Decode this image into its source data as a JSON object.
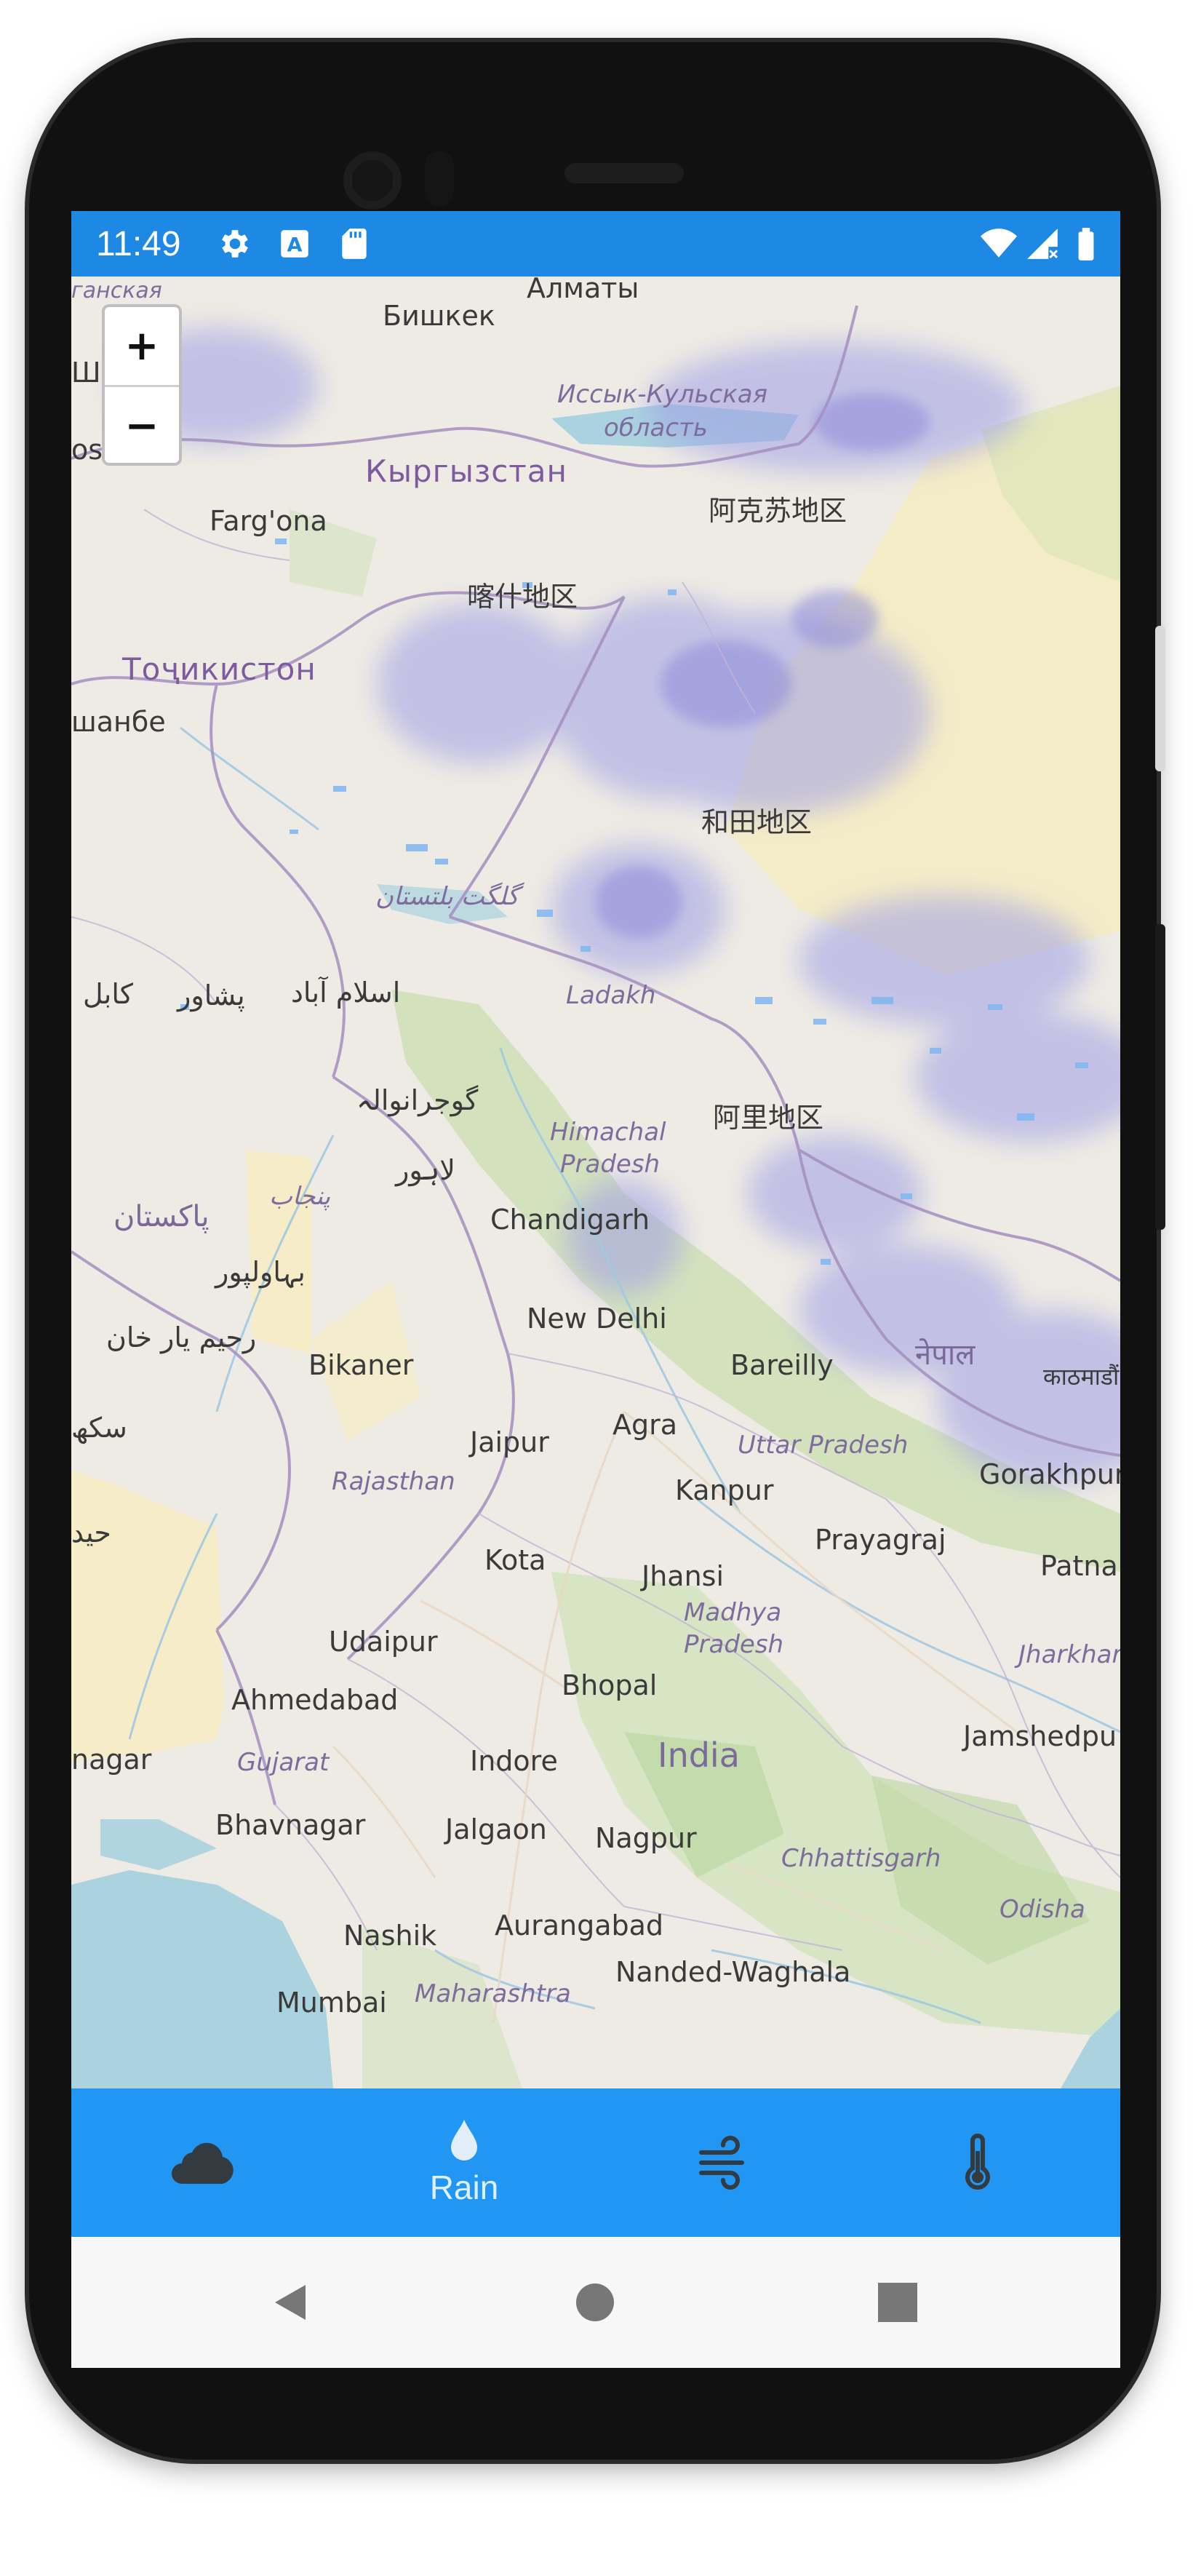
{
  "status_bar": {
    "time": "11:49",
    "left_icons": [
      "settings-icon",
      "text-a-icon",
      "sd-card-icon"
    ],
    "right_icons": [
      "wifi-icon",
      "signal-no-data-icon",
      "battery-icon"
    ]
  },
  "map": {
    "zoom_in_label": "+",
    "zoom_out_label": "−",
    "labels": {
      "almaty": "Алматы",
      "bishkek": "Бишкек",
      "issyk_kul": "Иссык-Кульская",
      "oblast": "область",
      "kyrgyzstan": "Кыргызстан",
      "aksu": "阿克苏地区",
      "fargona": "Farg'ona",
      "kashgar": "喀什地区",
      "tajikistan": "Тоҷикистон",
      "dushanbe": "шанбе",
      "hotan": "和田地区",
      "gilgit": "گلگت بلتستان",
      "kabul": "کابل",
      "peshawar": "پشاور",
      "islamabad": "اسلام آباد",
      "ladakh": "Ladakh",
      "gujranwala": "گوجرانوالہ",
      "ngari": "阿里地区",
      "himachal": "Himachal",
      "pradesh_h": "Pradesh",
      "lahore": "لاہور",
      "punjab": "پنجاب",
      "pakistan": "پاکستان",
      "chandigarh": "Chandigarh",
      "bahawalpur": "بہاولپور",
      "new_delhi": "New Delhi",
      "rahim_yar_khan": "رحیم یار خان",
      "bikaner": "Bikaner",
      "bareilly": "Bareilly",
      "nepal": "नेपाल",
      "kathmandu": "काठमाडौं",
      "sukkur": "سکھ",
      "jaipur": "Jaipur",
      "agra": "Agra",
      "uttar_pradesh": "Uttar Pradesh",
      "rajasthan": "Rajasthan",
      "kanpur": "Kanpur",
      "gorakhpur": "Gorakhpur",
      "hyderabad_pk": "حید",
      "prayagraj": "Prayagraj",
      "kota": "Kota",
      "jhansi": "Jhansi",
      "patna": "Patna",
      "madhya": "Madhya",
      "pradesh_m": "Pradesh",
      "udaipur": "Udaipur",
      "jharkhand": "Jharkhar",
      "bhopal": "Bhopal",
      "ahmedabad": "Ahmedabad",
      "jamshedpur": "Jamshedpu",
      "nagar": "nagar",
      "gujarat": "Gujarat",
      "indore": "Indore",
      "india": "India",
      "bhavnagar": "Bhavnagar",
      "jalgaon": "Jalgaon",
      "nagpur": "Nagpur",
      "chhattisgarh": "Chhattisgarh",
      "odisha": "Odisha",
      "nashik": "Nashik",
      "aurangabad": "Aurangabad",
      "nanded": "Nanded-Waghala",
      "mumbai": "Mumbai",
      "maharashtra": "Maharashtra",
      "kazakh_partial": "ганская",
      "shym_partial": "Ші",
      "osh_partial": "osh"
    }
  },
  "bottom_nav": {
    "items": [
      {
        "icon": "cloud-icon",
        "label": ""
      },
      {
        "icon": "raindrop-icon",
        "label": "Rain"
      },
      {
        "icon": "wind-icon",
        "label": ""
      },
      {
        "icon": "thermometer-icon",
        "label": ""
      }
    ],
    "active_index": 1
  },
  "android_nav": {
    "buttons": [
      "back-icon",
      "home-icon",
      "recents-icon"
    ]
  },
  "colors": {
    "status_bar": "#1e88e5",
    "bottom_nav": "#2196f3",
    "map_land": "#eeebe4",
    "water": "#aad3df",
    "forest": "#c9dfb0",
    "precip": "#9f9fe6",
    "desert": "#f4ecc2",
    "border": "#a38fbf"
  }
}
